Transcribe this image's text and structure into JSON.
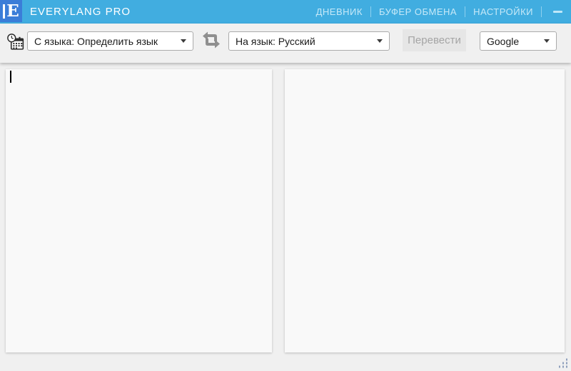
{
  "header": {
    "logo_letter": "E",
    "title": "EVERYLANG PRO",
    "menu": [
      {
        "label": "ДНЕВНИК"
      },
      {
        "label": "БУФЕР ОБМЕНА"
      },
      {
        "label": "НАСТРОЙКИ"
      }
    ]
  },
  "toolbar": {
    "source_lang": "С языка: Определить язык",
    "target_lang": "На язык: Русский",
    "translate_label": "Перевести",
    "provider": "Google"
  },
  "panels": {
    "source_text": "",
    "result_text": ""
  },
  "icons": {
    "history": "history-calendar-clock-icon",
    "swap": "swap-languages-icon",
    "dropdown": "chevron-down-icon",
    "minimize": "minimize-icon",
    "resize": "resize-grip-dots"
  },
  "colors": {
    "titlebar_bg": "#41ade0",
    "logo_bg": "#3b7dd8",
    "menu_text": "#c6e9f8",
    "toolbar_bg": "#f0f0f0",
    "panel_bg": "#f9f9f9",
    "disabled_button_bg": "#e6e6e6",
    "disabled_button_text": "#a5a5a5",
    "swap_icon": "#8f8f8f",
    "grip_dot": "#8fa0bd"
  }
}
